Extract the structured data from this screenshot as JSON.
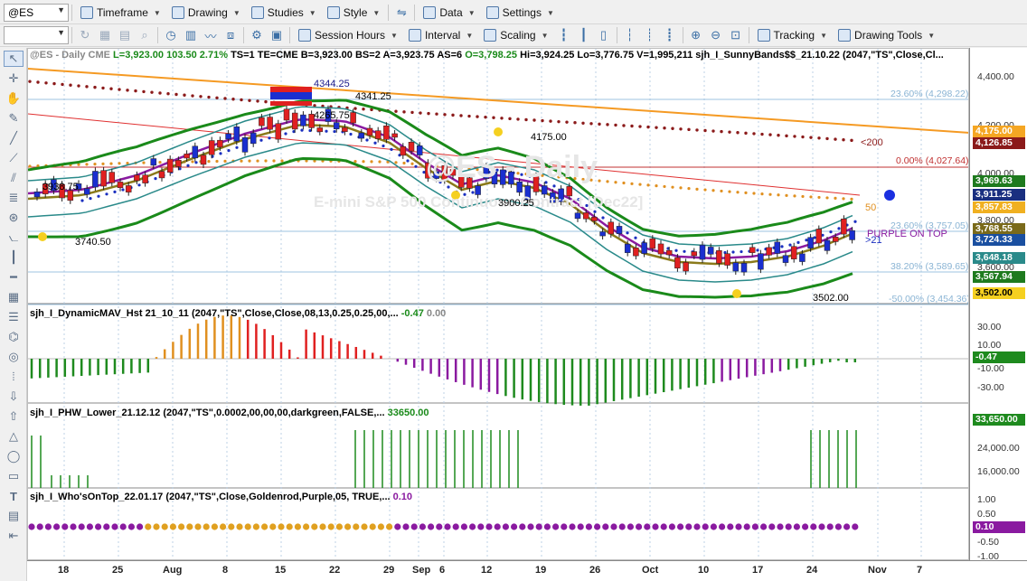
{
  "toolbar1": {
    "symbol": "@ES",
    "timeframe": "Timeframe",
    "drawing": "Drawing",
    "studies": "Studies",
    "style": "Style",
    "data": "Data",
    "settings": "Settings"
  },
  "toolbar2": {
    "session_hours": "Session Hours",
    "interval": "Interval",
    "scaling": "Scaling",
    "tracking": "Tracking",
    "drawing_tools": "Drawing Tools"
  },
  "price_header": {
    "symbol": "@ES - Daily",
    "exchange": "CME",
    "last": "L=3,923.00",
    "chg": "103.50",
    "pct": "2.71%",
    "ts": "TS=1",
    "te": "TE=CME",
    "bid": "B=3,923.00",
    "bs": "BS=2",
    "ask": "A=3,923.75",
    "as": "AS=6",
    "open": "O=3,798.25",
    "hi": "Hi=3,924.25",
    "lo": "Lo=3,776.75",
    "vol": "V=1,995,211",
    "study": "sjh_I_SunnyBands$$_21.10.22 (2047,\"TS\",Close,Cl..."
  },
  "watermark": {
    "line1": "@ES - Daily",
    "line2": "E-mini S&P 500 Continuous Contract [Dec22]"
  },
  "annotations": {
    "a1": "4344.25",
    "a2": "4341.25",
    "a3": "4265.75",
    "a4": "4175.00",
    "a5": "3938.75",
    "a6": "3900.25",
    "a7": "3740.50",
    "a8": "3502.00",
    "fib1": "23.60% (4,298.22)",
    "fib2": "0.00% (4,027.64)",
    "fib3": "23.60% (3,757.05)",
    "fib4": "38.20% (3,589.65)",
    "fib5": "-50.00% (3,454.36)",
    "ma200": "<200",
    "ma50": "50",
    "ma21": ">21",
    "purple_on_top": "PURPLE ON TOP"
  },
  "price_axis": {
    "ticks": [
      "4,400.00",
      "4,300.00",
      "4,200.00",
      "4,100.00",
      "4,000.00",
      "3,900.00",
      "3,800.00",
      "3,700.00",
      "3,600.00",
      "3,500.00"
    ],
    "tags": [
      {
        "label": "4,175.00",
        "bg": "#f5a623",
        "fg": "#ffffff"
      },
      {
        "label": "4,126.85",
        "bg": "#8b1a1a",
        "fg": "#ffffff"
      },
      {
        "label": "3,969.63",
        "bg": "#1e7a1e",
        "fg": "#ffffff"
      },
      {
        "label": "3,911.25",
        "bg": "#1a2f80",
        "fg": "#ffffff"
      },
      {
        "label": "3,857.83",
        "bg": "#f0b020",
        "fg": "#ffffff"
      },
      {
        "label": "3,768.55",
        "bg": "#7a6a1a",
        "fg": "#ffffff"
      },
      {
        "label": "3,724.33",
        "bg": "#1a4fa0",
        "fg": "#ffffff"
      },
      {
        "label": "3,648.18",
        "bg": "#2a8a8a",
        "fg": "#ffffff"
      },
      {
        "label": "3,567.94",
        "bg": "#1e7a1e",
        "fg": "#ffffff"
      },
      {
        "label": "3,502.00",
        "bg": "#f5d020",
        "fg": "#000000"
      }
    ]
  },
  "sub1": {
    "title": "sjh_I_DynamicMAV_Hst 21_10_11 (2047,\"TS\",Close,Close,08,13,0.25,0.25,00,...",
    "v1": "-0.47",
    "v2": "0.00",
    "ticks": [
      "30.00",
      "10.00",
      "-10.00",
      "-30.00"
    ],
    "tag": "-0.47"
  },
  "sub2": {
    "title": "sjh_I_PHW_Lower_21.12.12 (2047,\"TS\",0.0002,00,00,00,darkgreen,FALSE,...",
    "v1": "33650.00",
    "ticks": [
      "24,000.00",
      "16,000.00"
    ],
    "tag": "33,650.00"
  },
  "sub3": {
    "title": "sjh_I_Who'sOnTop_22.01.17 (2047,\"TS\",Close,Goldenrod,Purple,05, TRUE,...",
    "v1": "0.10",
    "ticks": [
      "1.00",
      "0.50",
      "0.00",
      "-0.50",
      "-1.00"
    ],
    "tag": "0.10"
  },
  "xaxis": {
    "labels": [
      "18",
      "25",
      "Aug",
      "8",
      "15",
      "22",
      "29",
      "Sep",
      "6",
      "12",
      "19",
      "26",
      "Oct",
      "10",
      "17",
      "24",
      "Nov",
      "7"
    ]
  }
}
